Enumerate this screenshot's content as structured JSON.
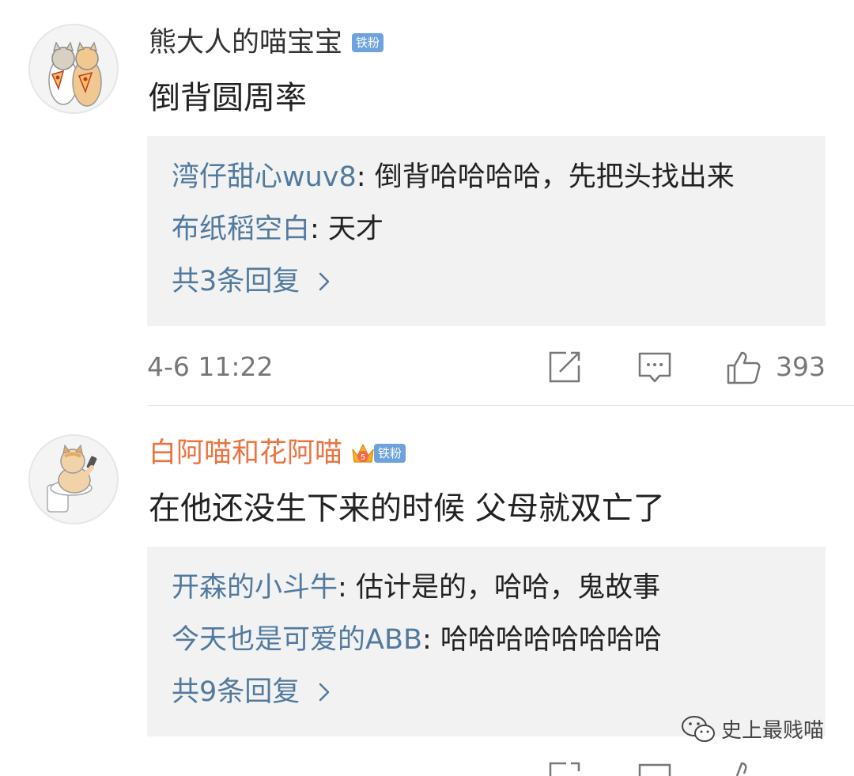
{
  "comments": [
    {
      "username": "熊大人的喵宝宝",
      "badge": "铁粉",
      "text": "倒背圆周率",
      "replies": [
        {
          "user": "湾仔甜心wuv8",
          "sep": ": ",
          "text": "倒背哈哈哈哈，先把头找出来"
        },
        {
          "user": "布纸稻空白",
          "sep": ": ",
          "text": "天才"
        }
      ],
      "more_replies": "共3条回复",
      "time": "4-6 11:22",
      "likes": "393"
    },
    {
      "username": "白阿喵和花阿喵",
      "badge": "铁粉",
      "badge_level": "5",
      "text": "在他还没生下来的时候 父母就双亡了",
      "replies": [
        {
          "user": "开森的小斗牛",
          "sep": ": ",
          "text": "估计是的，哈哈，鬼故事"
        },
        {
          "user": "今天也是可爱的ABB",
          "sep": ": ",
          "text": "哈哈哈哈哈哈哈哈"
        }
      ],
      "more_replies": "共9条回复"
    }
  ],
  "watermark": "史上最贱喵",
  "colors": {
    "link_blue": "#52799e",
    "vip_orange": "#eb7340",
    "badge_blue": "#6ea2dc",
    "reply_bg": "#f2f2f2"
  },
  "icons": [
    "repost-icon",
    "comment-icon",
    "like-icon",
    "chevron-right-icon",
    "wechat-icon"
  ]
}
